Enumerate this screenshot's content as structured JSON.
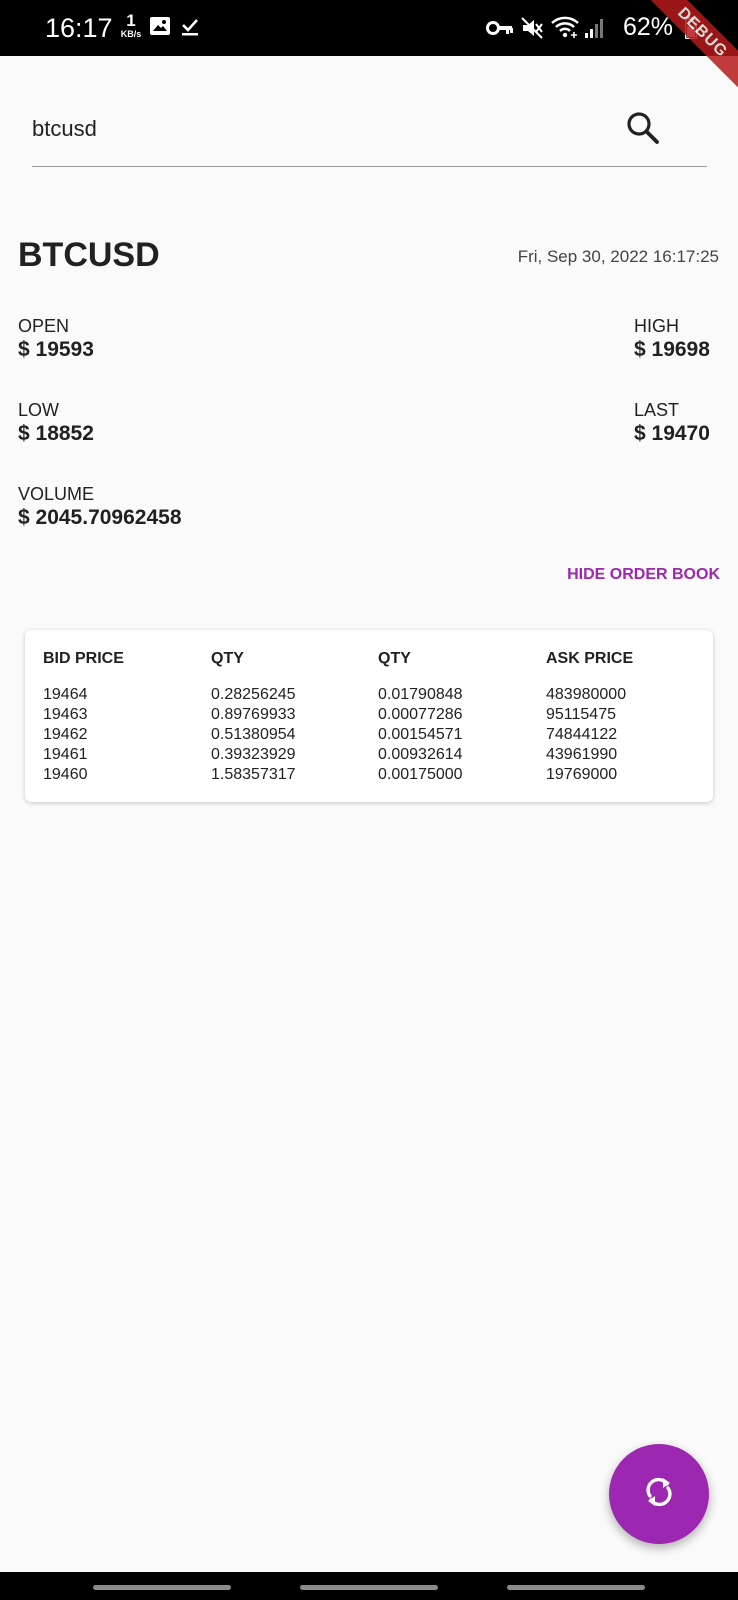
{
  "status_bar": {
    "time": "16:17",
    "net_speed_value": "1",
    "net_speed_unit": "KB/s",
    "battery": "62%",
    "icons": [
      "image-icon",
      "download-done-icon",
      "vpn-key-icon",
      "mute-icon",
      "wifi-icon",
      "signal-icon",
      "battery-icon"
    ]
  },
  "debug_banner": "DEBUG",
  "search": {
    "value": "btcusd",
    "icon": "search-icon"
  },
  "ticker": {
    "symbol": "BTCUSD",
    "timestamp": "Fri, Sep 30, 2022 16:17:25",
    "open_label": "OPEN",
    "open_value": "$ 19593",
    "high_label": "HIGH",
    "high_value": "$ 19698",
    "low_label": "LOW",
    "low_value": "$ 18852",
    "last_label": "LAST",
    "last_value": "$ 19470",
    "volume_label": "VOLUME",
    "volume_value": "$ 2045.70962458"
  },
  "order_book_toggle": "HIDE ORDER BOOK",
  "order_book": {
    "headers": [
      "BID PRICE",
      "QTY",
      "QTY",
      "ASK PRICE"
    ],
    "bid_prices": [
      "19464",
      "19463",
      "19462",
      "19461",
      "19460"
    ],
    "bid_qty": [
      "0.28256245",
      "0.89769933",
      "0.51380954",
      "0.39323929",
      "1.58357317"
    ],
    "ask_qty": [
      "0.01790848",
      "0.00077286",
      "0.00154571",
      "0.00932614",
      "0.00175000"
    ],
    "ask_prices": [
      "483980000",
      "95115475",
      "74844122",
      "43961990",
      "19769000"
    ]
  },
  "fab": {
    "icon": "refresh-icon"
  },
  "colors": {
    "accent": "#9c27b0",
    "background": "#fafafa",
    "status_bar": "#000000",
    "debug_ribbon": "#b71c1c"
  }
}
